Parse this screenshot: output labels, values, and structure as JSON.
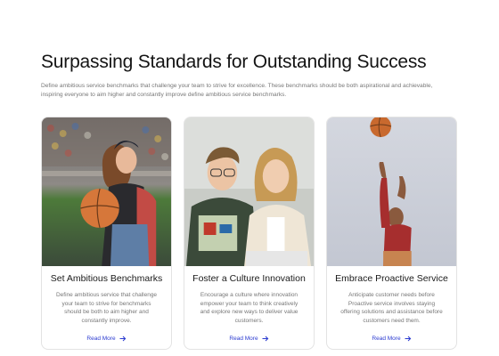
{
  "header": {
    "title": "Surpassing Standards for Outstanding Success",
    "subtitle": "Define ambitious service benchmarks that challenge your team to strive for excellence. These benchmarks should be both aspirational and achievable, inspiring everyone to aim higher and constantly improve define ambitious service benchmarks."
  },
  "cards": [
    {
      "title": "Set Ambitious Benchmarks",
      "text": "Define ambitious service that challenge your team to strive for benchmarks should be both to aim higher and constantly improve.",
      "link": "Read More",
      "image_icon": "photo-woman-with-basketball"
    },
    {
      "title": "Foster a Culture Innovation",
      "text": "Encourage a culture where innovation empower your team to think creatively and explore new ways to deliver value customers.",
      "link": "Read More",
      "image_icon": "photo-two-students-reading"
    },
    {
      "title": "Embrace Proactive Service",
      "text": "Anticipate customer needs before Proactive service involves staying offering solutions and assistance before customers need them.",
      "link": "Read More",
      "image_icon": "photo-basketball-player-jumping"
    }
  ],
  "colors": {
    "link": "#2b3bd0",
    "title": "#141414",
    "muted": "#777777",
    "border": "#e3e3e3"
  }
}
